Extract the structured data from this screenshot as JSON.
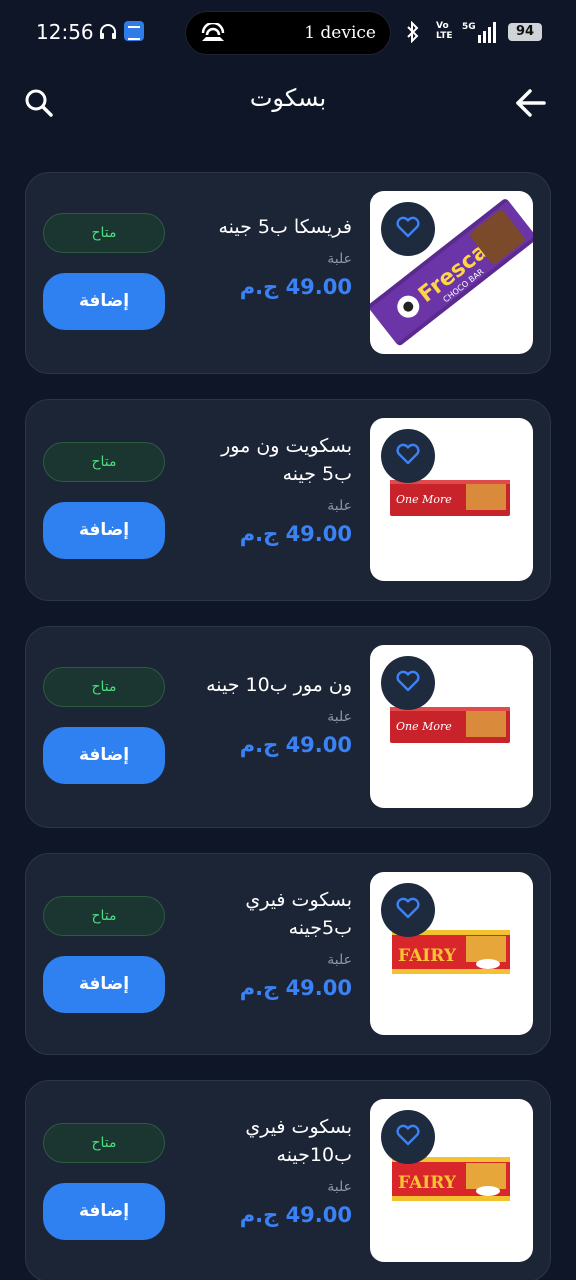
{
  "status_bar": {
    "time": "12:56",
    "hotspot_text": "1 device",
    "volte": "Vo\nLTE",
    "network": "5G",
    "battery": "94"
  },
  "header": {
    "title": "بسكوت"
  },
  "products": [
    {
      "name": "فريسكا ب5 جينه",
      "unit": "علبة",
      "price": "49.00 ج.م",
      "status": "متاح",
      "add_label": "إضافة",
      "image": "fresca-choco-bar"
    },
    {
      "name": "بسكويت ون مور ب5 جينه",
      "unit": "علبة",
      "price": "49.00 ج.م",
      "status": "متاح",
      "add_label": "إضافة",
      "image": "one-more-biscuit"
    },
    {
      "name": "ون مور ب10 جينه",
      "unit": "علبة",
      "price": "49.00 ج.م",
      "status": "متاح",
      "add_label": "إضافة",
      "image": "one-more-biscuit"
    },
    {
      "name": "بسكوت فيري ب5جينه",
      "unit": "علبة",
      "price": "49.00 ج.م",
      "status": "متاح",
      "add_label": "إضافة",
      "image": "fairy-biscuit"
    },
    {
      "name": "بسكوت فيري ب10جينه",
      "unit": "علبة",
      "price": "49.00 ج.م",
      "status": "متاح",
      "add_label": "إضافة",
      "image": "fairy-biscuit"
    }
  ],
  "product_image_labels": {
    "fresca": "Fresca",
    "fresca_sub": "CHOCO BAR",
    "one_more": "One More",
    "fairy": "FAIRY"
  },
  "colors": {
    "background": "#0f1627",
    "card": "#1c2536",
    "accent": "#2f80f1",
    "price": "#3b82f6",
    "available": "#4ade80"
  }
}
